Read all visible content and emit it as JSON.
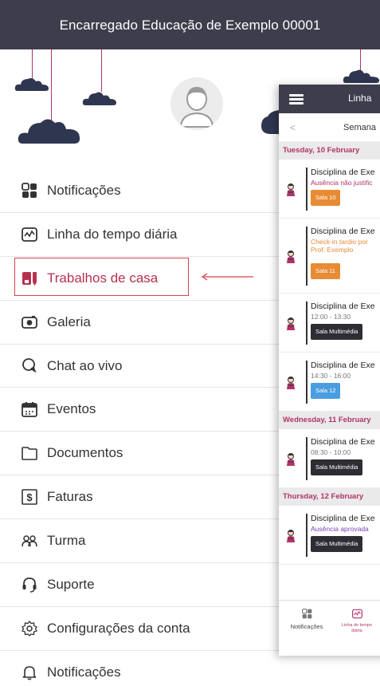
{
  "header": {
    "title": "Encarregado Educação de Exemplo 00001"
  },
  "menu": {
    "items": [
      {
        "label": "Notificações",
        "icon": "grid-icon",
        "active": false
      },
      {
        "label": "Linha do tempo diária",
        "icon": "timeline-icon",
        "active": false
      },
      {
        "label": "Trabalhos de casa",
        "icon": "homework-icon",
        "active": true
      },
      {
        "label": "Galeria",
        "icon": "camera-icon",
        "active": false
      },
      {
        "label": "Chat ao vivo",
        "icon": "chat-icon",
        "active": false
      },
      {
        "label": "Eventos",
        "icon": "calendar-icon",
        "active": false
      },
      {
        "label": "Documentos",
        "icon": "folder-icon",
        "active": false
      },
      {
        "label": "Faturas",
        "icon": "invoice-icon",
        "active": false
      },
      {
        "label": "Turma",
        "icon": "group-icon",
        "active": false
      },
      {
        "label": "Suporte",
        "icon": "headset-icon",
        "active": false
      },
      {
        "label": "Configurações da conta",
        "icon": "gear-icon",
        "active": false
      },
      {
        "label": "Notificações",
        "icon": "bell-icon",
        "active": false
      }
    ]
  },
  "panel": {
    "title": "Linha",
    "back": "<",
    "week_label": "Semana",
    "days": [
      {
        "label": "Tuesday, 10 February",
        "events": [
          {
            "title": "Disciplina de Exe",
            "sub": [
              "Ausência não justific"
            ],
            "sub_color": "#b0336a",
            "room": "Sala 10",
            "room_color": "#e88b35"
          },
          {
            "title": "Disciplina de Exe",
            "sub": [
              "Check-in tardio por",
              "Prof. Exemplo"
            ],
            "sub_color": "#e88b35",
            "room": "Sala 11",
            "room_color": "#e88b35"
          },
          {
            "title": "Disciplina de Exe",
            "sub": [
              "12:00 - 13:30"
            ],
            "sub_color": "#777777",
            "room": "Sala Multimédia",
            "room_color": "#2d2d33"
          },
          {
            "title": "Disciplina de Exe",
            "sub": [
              "14:30 - 16:00"
            ],
            "sub_color": "#777777",
            "room": "Sala 12",
            "room_color": "#4a9ee0"
          }
        ]
      },
      {
        "label": "Wednesday, 11 February",
        "events": [
          {
            "title": "Disciplina de Exe",
            "sub": [
              "08:30 - 10:00"
            ],
            "sub_color": "#777777",
            "room": "Sala Multimédia",
            "room_color": "#2d2d33"
          }
        ]
      },
      {
        "label": "Thursday, 12 February",
        "events": [
          {
            "title": "Disciplina de Exe",
            "sub": [
              "Ausência aprovada"
            ],
            "sub_color": "#7b3fb8",
            "room": "Sala Multimédia",
            "room_color": "#2d2d33"
          }
        ]
      }
    ],
    "footer": [
      {
        "label": "Notificações",
        "icon": "grid-icon"
      },
      {
        "label": "Linha do tempo diária",
        "icon": "timeline-icon",
        "active": true
      }
    ]
  },
  "colors": {
    "header_bg": "#3d3d4c",
    "accent": "#b0336a",
    "highlight": "#d9424e"
  }
}
